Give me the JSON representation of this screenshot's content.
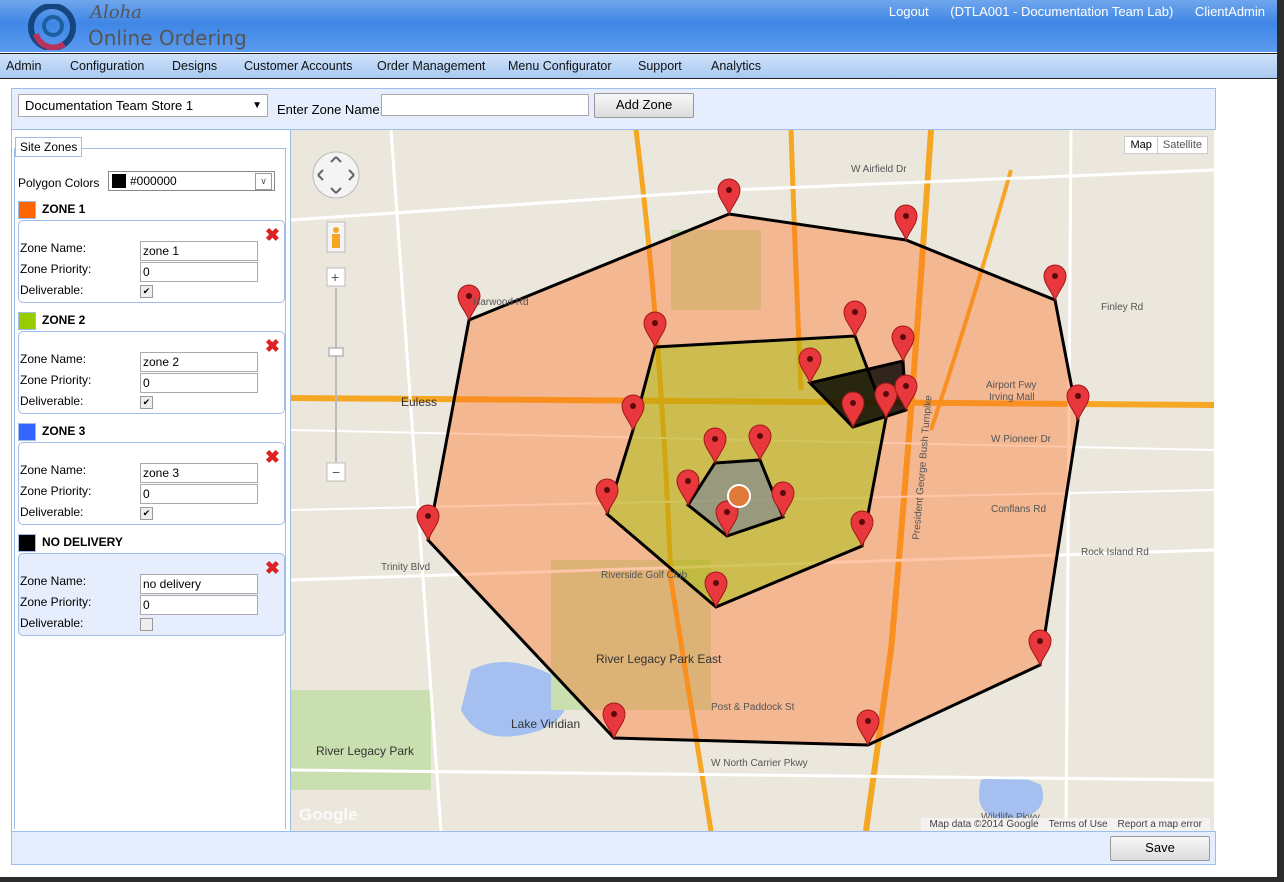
{
  "header": {
    "brand_script": "Aloha",
    "brand": "Online Ordering",
    "logout": "Logout",
    "account": "(DTLA001 - Documentation Team Lab)",
    "user": "ClientAdmin"
  },
  "nav": [
    "Admin",
    "Configuration",
    "Designs",
    "Customer Accounts",
    "Order Management",
    "Menu Configurator",
    "Support",
    "Analytics"
  ],
  "toolbar": {
    "store": "Documentation Team Store 1",
    "zone_label": "Enter Zone Name:",
    "zone_value": "",
    "add_zone": "Add Zone"
  },
  "site_zones": {
    "legend": "Site Zones",
    "polygon_colors_label": "Polygon Colors",
    "polygon_color": "#000000",
    "field_labels": {
      "name": "Zone Name:",
      "priority": "Zone Priority:",
      "deliverable": "Deliverable:"
    },
    "zones": [
      {
        "title": "ZONE 1",
        "color": "#ff6600",
        "name": "zone 1",
        "priority": "0",
        "deliverable": true
      },
      {
        "title": "ZONE 2",
        "color": "#99cc00",
        "name": "zone 2",
        "priority": "0",
        "deliverable": true
      },
      {
        "title": "ZONE 3",
        "color": "#3366ff",
        "name": "zone 3",
        "priority": "0",
        "deliverable": true
      },
      {
        "title": "NO DELIVERY",
        "color": "#000000",
        "name": "no delivery",
        "priority": "0",
        "deliverable": false
      }
    ]
  },
  "map": {
    "map_btn": "Map",
    "satellite_btn": "Satellite",
    "attribution": "Map data ©2014 Google",
    "terms": "Terms of Use",
    "report": "Report a map error",
    "google": "Google",
    "labels": [
      "Euless",
      "Airport Fwy",
      "Irving Mall",
      "River Legacy Park East",
      "Lake Viridian",
      "River Legacy Park",
      "Riverside Golf Club",
      "W North Carrier Pkwy",
      "President George Bush Turnpike",
      "Trinity Blvd",
      "Harwood Rd",
      "W Pioneer Dr",
      "Conflans Rd",
      "Rock Island Rd",
      "W Airfield Dr",
      "Finley Rd",
      "Post & Paddock St",
      "Wildlife Pkwy"
    ]
  },
  "footer": {
    "save": "Save"
  }
}
